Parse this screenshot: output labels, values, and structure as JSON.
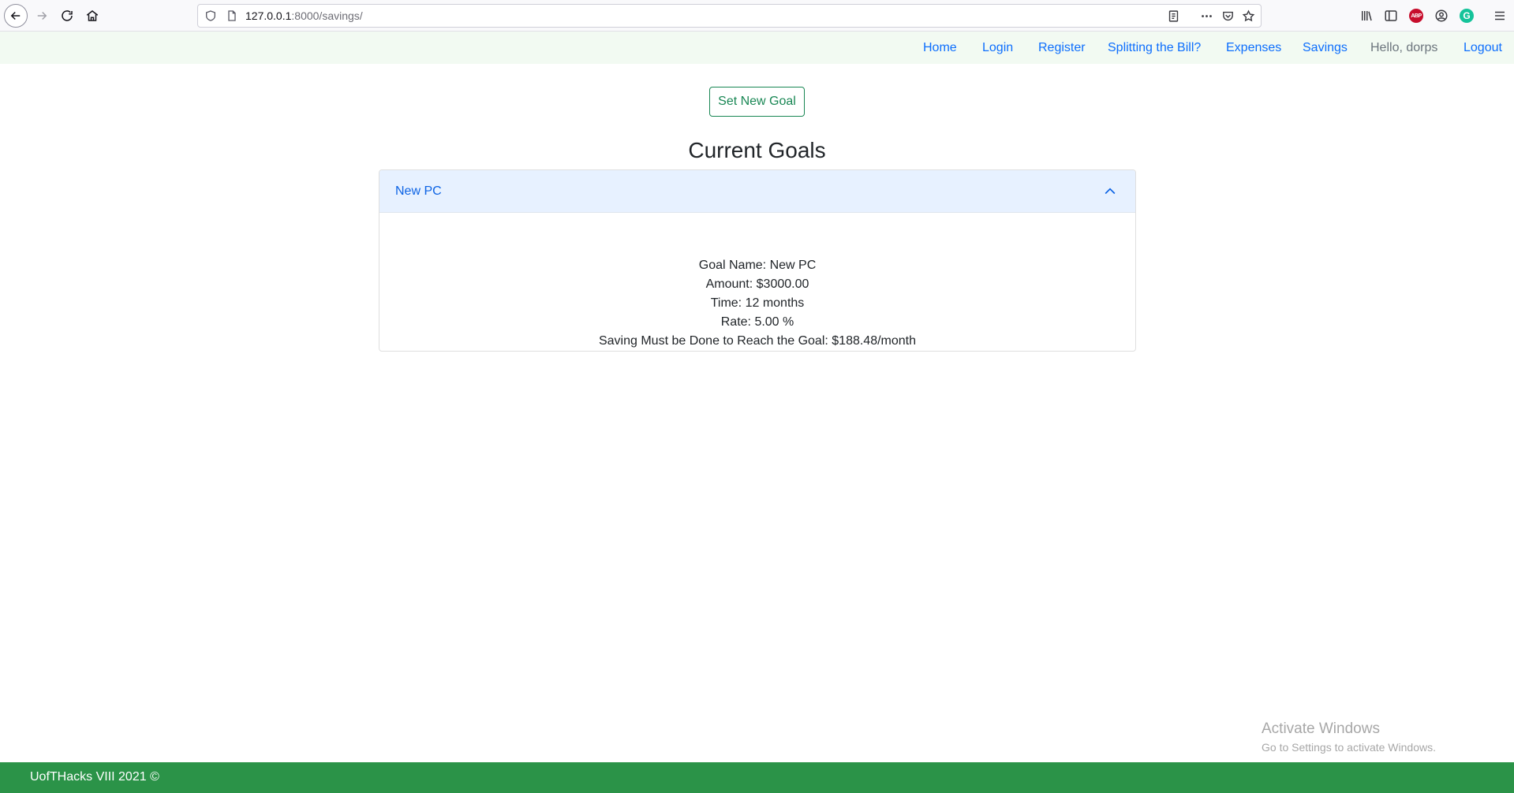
{
  "browser": {
    "url_host": "127.0.0.1",
    "url_path": ":8000/savings/",
    "abp_label": "ABP",
    "grammarly_label": "G"
  },
  "nav": {
    "home": "Home",
    "login": "Login",
    "register": "Register",
    "split": "Splitting the Bill?",
    "expenses": "Expenses",
    "savings": "Savings",
    "hello": "Hello, dorps",
    "logout": "Logout"
  },
  "main": {
    "set_goal_label": "Set New Goal",
    "title": "Current Goals",
    "goal": {
      "header": "New PC",
      "lines": [
        "Goal Name: New PC",
        "Amount: $3000.00",
        "Time: 12 months",
        "Rate: 5.00 %",
        "Saving Must be Done to Reach the Goal: $188.48/month"
      ]
    }
  },
  "watermark": {
    "line1": "Activate Windows",
    "line2": "Go to Settings to activate Windows."
  },
  "footer": {
    "text": "UofTHacks VIII 2021 ©"
  },
  "colors": {
    "accent_green": "#198754",
    "footer_green": "#2b9348",
    "link_blue": "#0d6efd"
  }
}
